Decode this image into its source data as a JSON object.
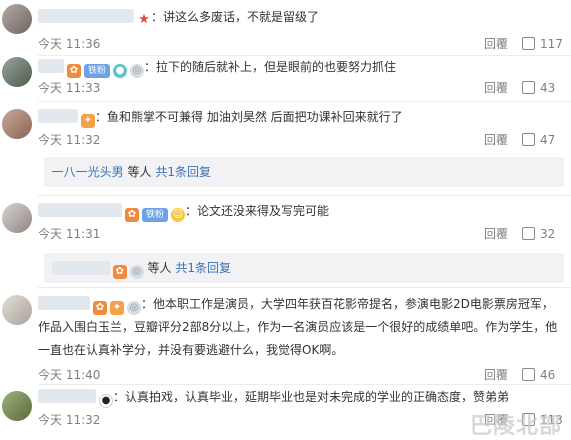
{
  "comments": [
    {
      "text": "：讲这么多废话，不就是留级了",
      "time": "今天 11:36",
      "reply": "回覆",
      "likes": "117"
    },
    {
      "badge_fan": "铁粉",
      "text": "：拉下的随后就补上，但是眼前的也要努力抓住",
      "time": "今天 11:33",
      "reply": "回覆",
      "likes": "43"
    },
    {
      "text": "：鱼和熊掌不可兼得 加油刘昊然 后面把功课补回来就行了",
      "time": "今天 11:32",
      "reply": "回覆",
      "likes": "47",
      "sub_user": "一八一光头男",
      "sub_tail": "等人",
      "sub_link": "共1条回复"
    },
    {
      "badge_fan": "铁粉",
      "text": "：论文还没来得及写完可能",
      "time": "今天 11:31",
      "reply": "回覆",
      "likes": "32",
      "sub_tail": "等人",
      "sub_link": "共1条回复"
    },
    {
      "text_l1": "：他本职工作是演员，大学四年获百花影帝提名，参演电影2D电影票房冠军，",
      "text_l2": "作品入围白玉兰，豆瓣评分2部8分以上，作为一名演员应该是一个很好的成绩单吧。作为学生，他",
      "text_l3": "一直也在认真补学分，并没有要逃避什么，我觉得OK啊。",
      "time": "今天 11:40",
      "reply": "回覆",
      "likes": "46"
    },
    {
      "text": "：认真拍戏，认真毕业，延期毕业也是对未完成的学业的正确态度，赞弟弟",
      "time": "今天 11:32",
      "reply": "回覆",
      "likes": "113"
    }
  ],
  "icons": {
    "star": "★",
    "medal": "◎",
    "emoji": "☺",
    "panda": "●",
    "fire": "✦",
    "vip": "✿",
    "cam": "●"
  },
  "watermark": "巴陵北部"
}
